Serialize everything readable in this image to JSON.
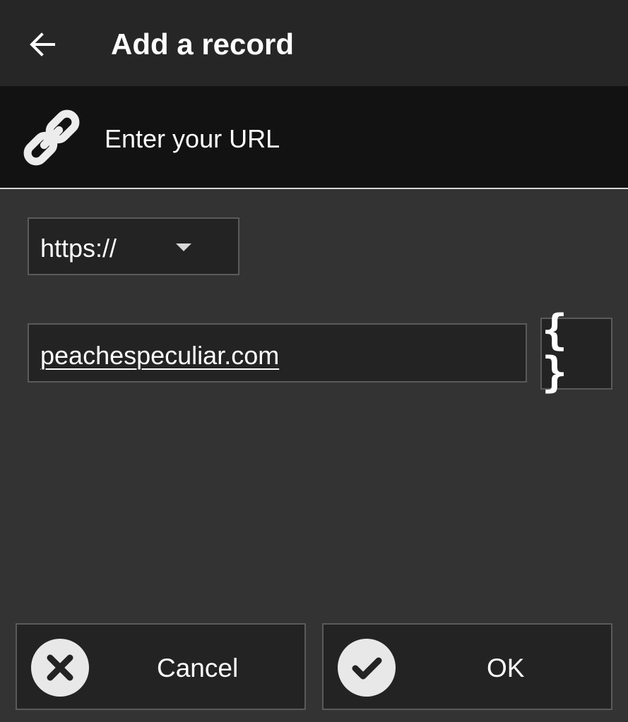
{
  "appbar": {
    "title": "Add a record",
    "back_icon": "arrow-left-icon"
  },
  "subheader": {
    "icon": "link-icon",
    "label": "Enter your URL"
  },
  "form": {
    "scheme": {
      "selected": "https://"
    },
    "url": {
      "value": "peachespeculiar.com"
    },
    "variables_button": {
      "icon": "curly-braces-icon",
      "glyph": "{ }"
    }
  },
  "actions": {
    "cancel_label": "Cancel",
    "cancel_icon": "close-circle-icon",
    "ok_label": "OK",
    "ok_icon": "check-circle-icon"
  },
  "colors": {
    "background": "#333333",
    "appbar": "#262626",
    "subheader": "#121212",
    "field": "#232323",
    "border": "#5a5a5a",
    "icon_fill": "#e8e8e8"
  }
}
